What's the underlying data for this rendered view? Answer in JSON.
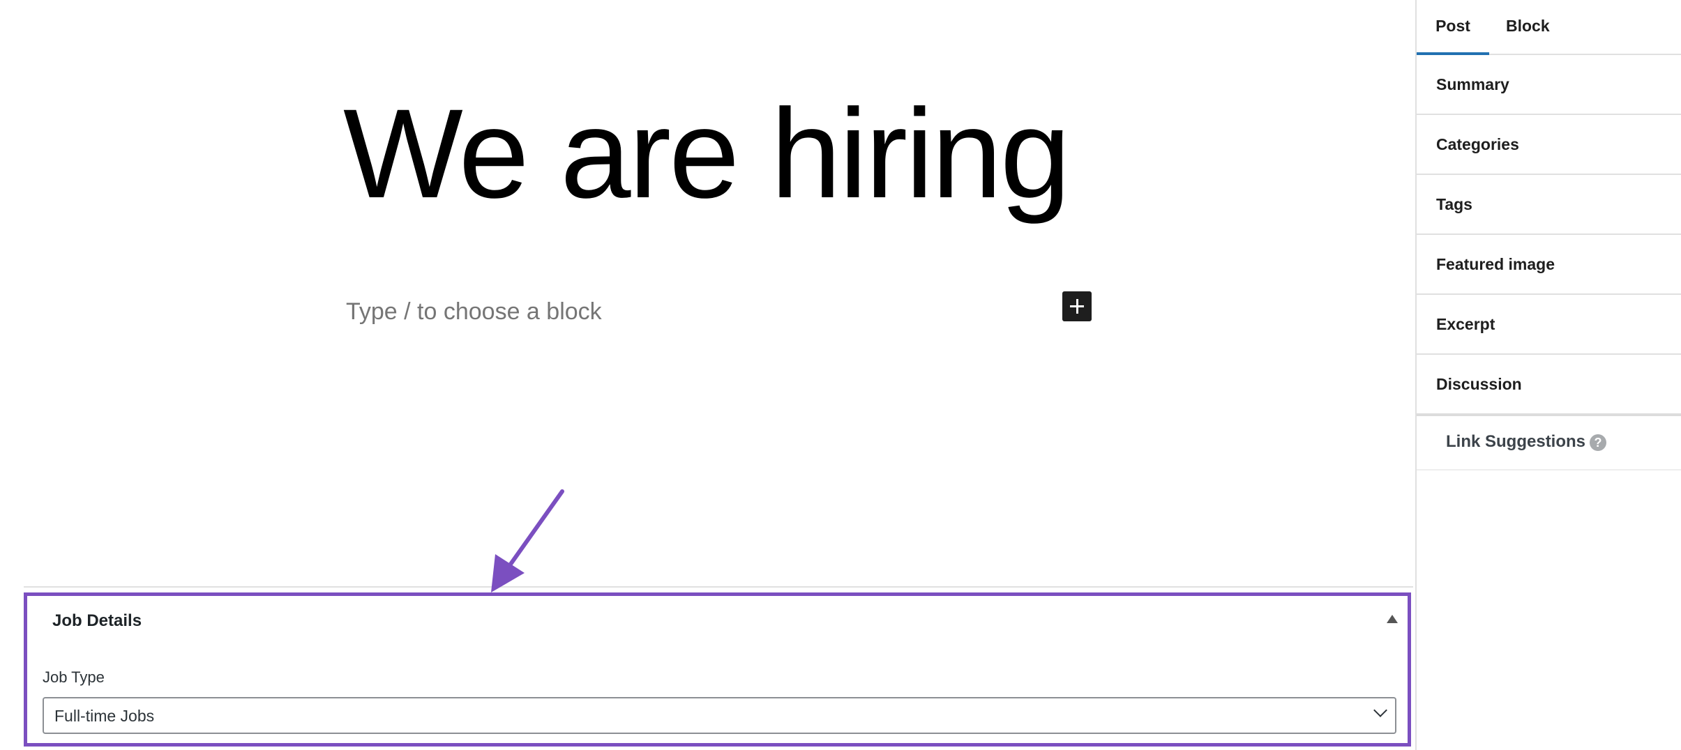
{
  "editor": {
    "post_title": "We are hiring",
    "block_placeholder": "Type / to choose a block",
    "add_block_icon": "plus-icon"
  },
  "sidebar": {
    "tabs": [
      {
        "label": "Post",
        "active": true
      },
      {
        "label": "Block",
        "active": false
      }
    ],
    "panels": [
      "Summary",
      "Categories",
      "Tags",
      "Featured image",
      "Excerpt",
      "Discussion"
    ],
    "link_suggestions": "Link Suggestions",
    "help_icon": "question-icon",
    "accent_color": "#2271b1"
  },
  "metabox": {
    "title": "Job Details",
    "field_label": "Job Type",
    "select_value": "Full-time Jobs",
    "highlight_color": "#7b4fc0"
  }
}
